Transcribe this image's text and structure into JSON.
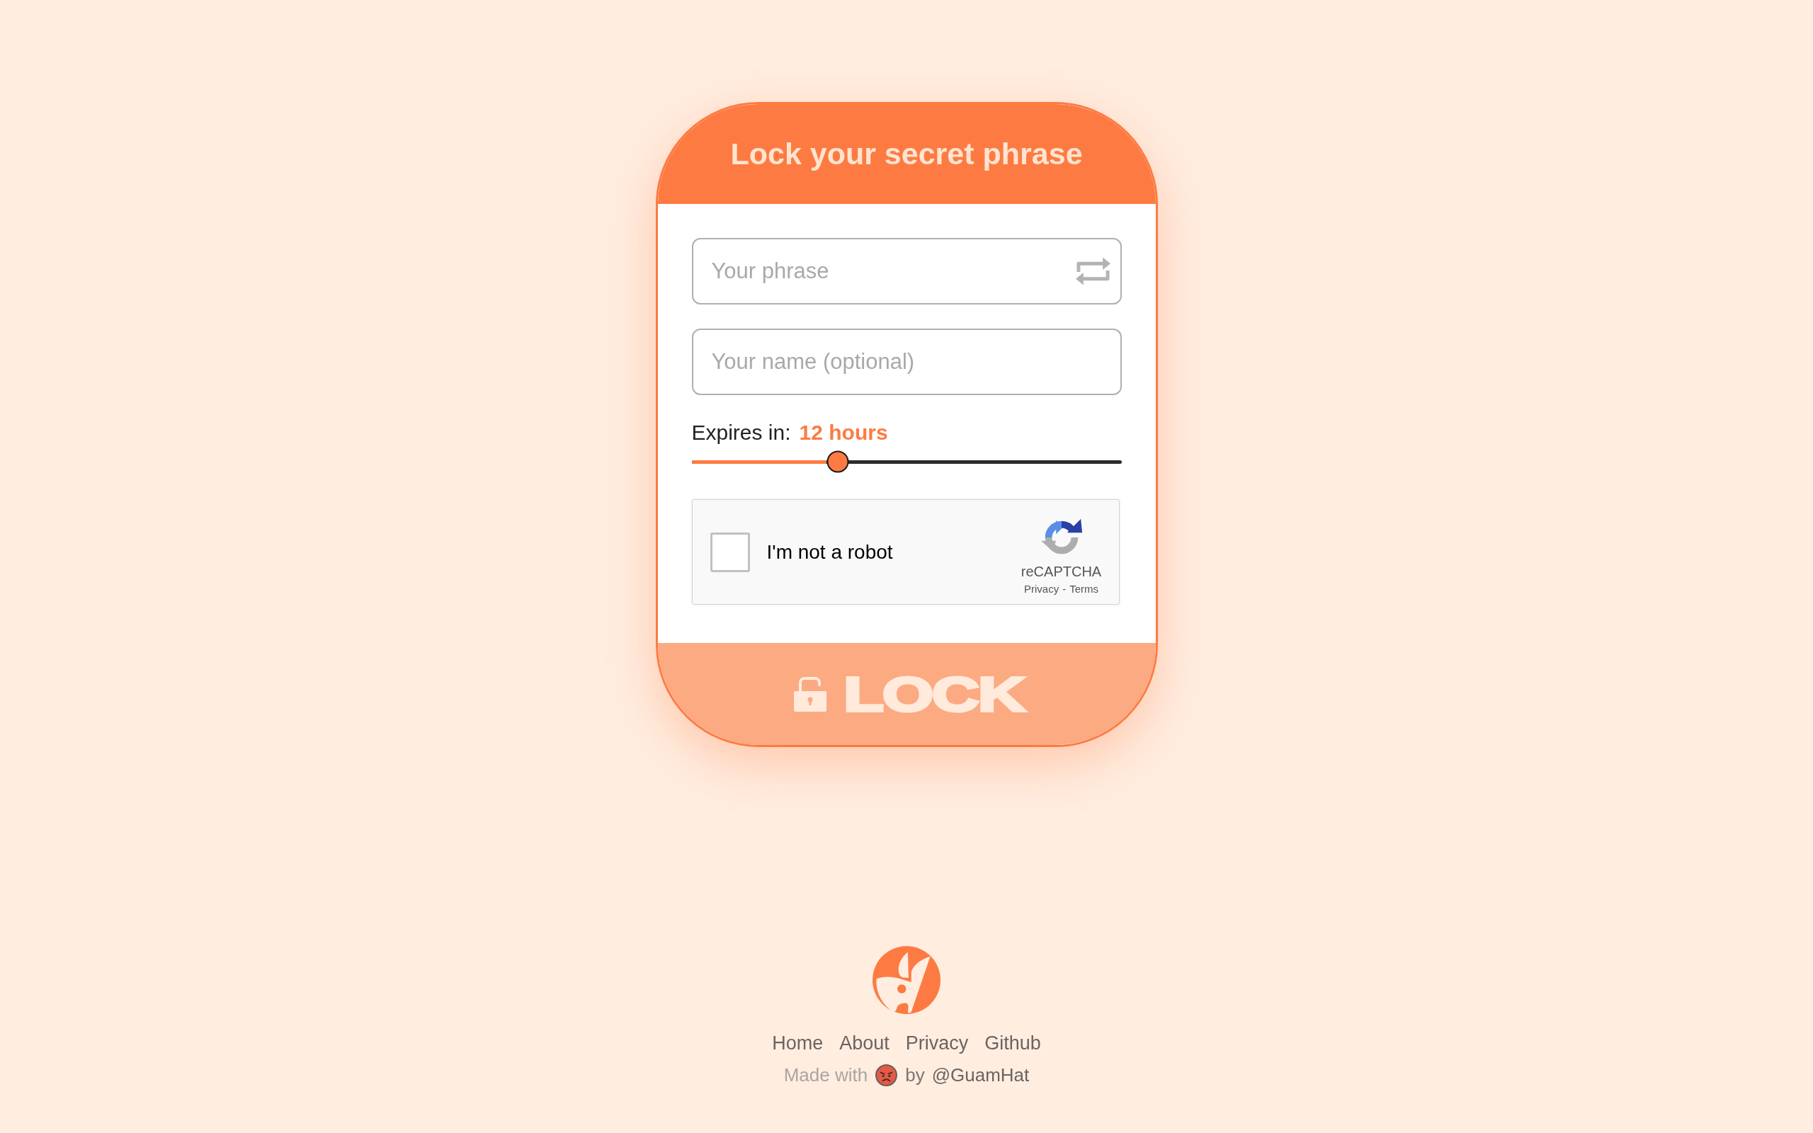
{
  "form": {
    "title": "Lock your secret phrase",
    "fields": [
      {
        "kind": "phrase",
        "placeholder": "Your phrase"
      },
      {
        "kind": "text",
        "placeholder": "Your name (optional)"
      }
    ],
    "expiry": {
      "label": "Expires in:",
      "value": "12 hours",
      "level": 0.34
    },
    "captcha": {
      "label": "I'm not a robot",
      "checked": false,
      "brand": "reCAPTCHA",
      "links": [
        "Privacy",
        "Terms"
      ],
      "separator": "-"
    },
    "submit": {
      "label": "LOCK",
      "disabled": true
    }
  },
  "footer": {
    "links": [
      "Home",
      "About",
      "Privacy",
      "Github"
    ],
    "credit": {
      "prefix": "Made with",
      "joiner": "by",
      "author": "@GuamHat"
    }
  }
}
